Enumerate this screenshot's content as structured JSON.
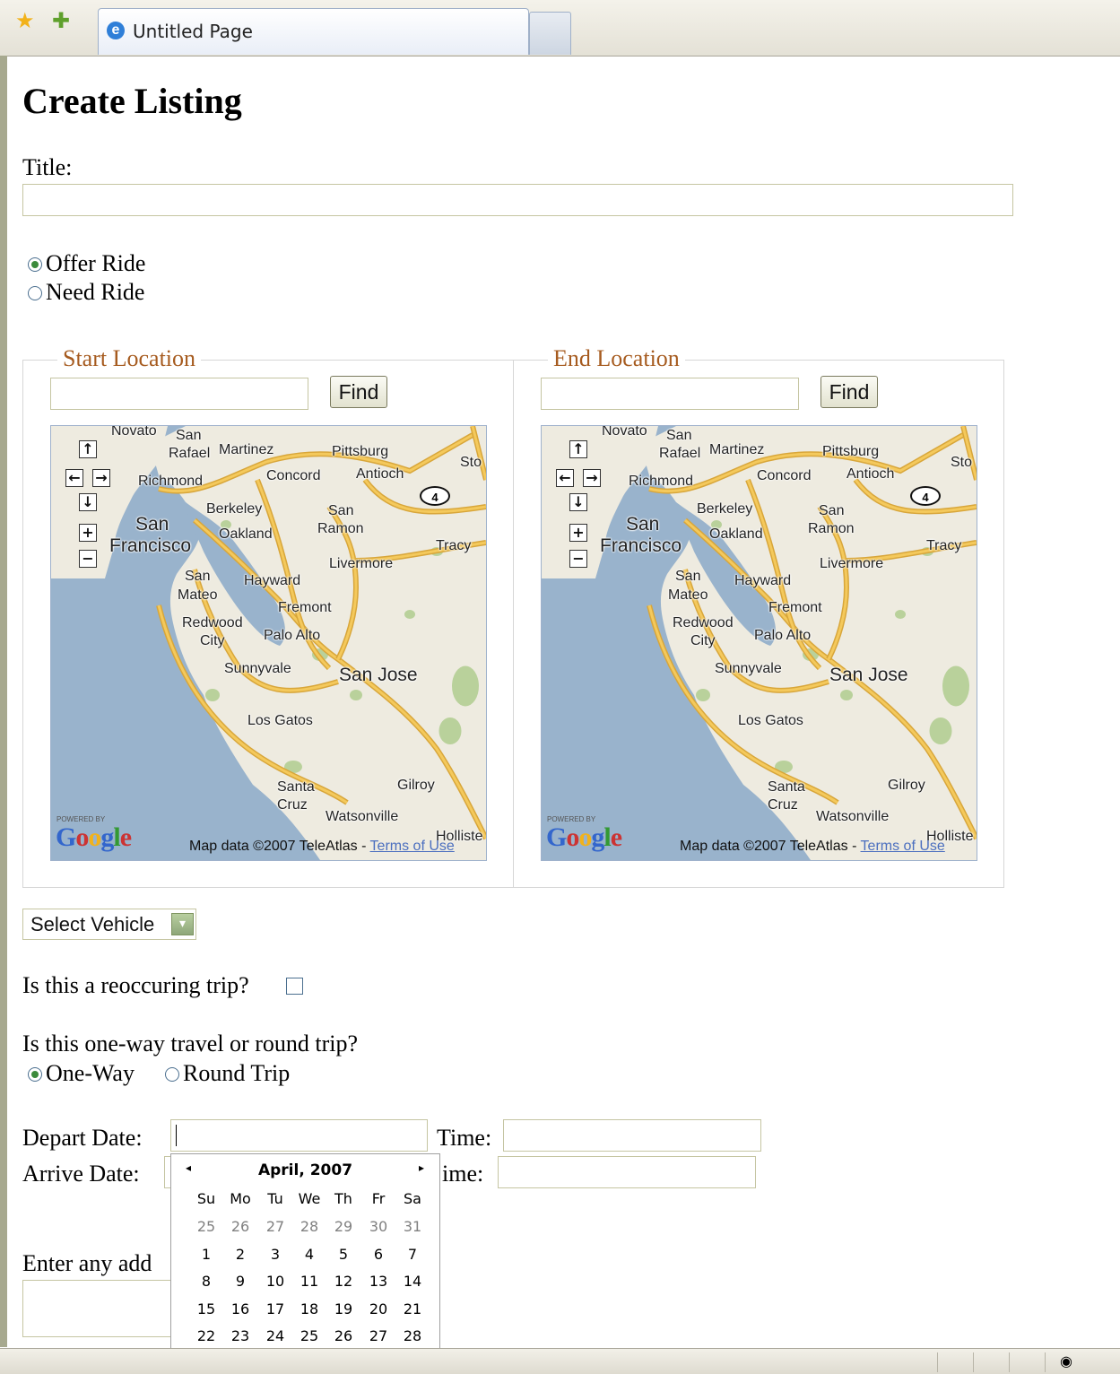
{
  "browser": {
    "tab_title": "Untitled Page",
    "favorites_icon": "star-icon",
    "add_favorites_icon": "add-favorite-icon",
    "page_icon": "ie-icon",
    "privacy_icon": "privacy-eye-icon"
  },
  "page": {
    "heading": "Create Listing",
    "title_label": "Title:",
    "title_value": "",
    "ride_options": [
      {
        "label": "Offer Ride",
        "checked": true
      },
      {
        "label": "Need Ride",
        "checked": false
      }
    ],
    "start_location": {
      "legend": "Start Location",
      "value": "",
      "find_label": "Find"
    },
    "end_location": {
      "legend": "End Location",
      "value": "",
      "find_label": "Find"
    },
    "map": {
      "powered_by": "POWERED BY",
      "logo_text": "Google",
      "attribution": "Map data ©2007 TeleAtlas - ",
      "terms": "Terms of Use",
      "controls": [
        "↑",
        "←",
        "→",
        "↓",
        "+",
        "−"
      ],
      "highway_shield": "4",
      "places": [
        "Novato",
        "San Rafael",
        "Martinez",
        "Pittsburg",
        "Sto",
        "Richmond",
        "Concord",
        "Antioch",
        "Berkeley",
        "San Francisco",
        "Oakland",
        "San Ramon",
        "Tracy",
        "Livermore",
        "San Mateo",
        "Hayward",
        "Fremont",
        "Redwood City",
        "Palo Alto",
        "Sunnyvale",
        "San Jose",
        "Los Gatos",
        "Santa Cruz",
        "Gilroy",
        "Watsonville",
        "Holliste"
      ]
    },
    "vehicle_select": {
      "selected": "Select Vehicle"
    },
    "reoccurring_label": "Is this a reoccuring trip?",
    "reoccurring_checked": false,
    "travel_question": "Is this one-way travel or round trip?",
    "travel_options": [
      {
        "label": "One-Way",
        "checked": true
      },
      {
        "label": "Round Trip",
        "checked": false
      }
    ],
    "depart_label": "Depart Date:",
    "arrive_label": "Arrive Date:",
    "time_label": "Time:",
    "time_label_partial": "ime:",
    "additional_label": "Enter any add"
  },
  "calendar": {
    "month_label": "April, 2007",
    "prev": "◂",
    "next": "▸",
    "weekdays": [
      "Su",
      "Mo",
      "Tu",
      "We",
      "Th",
      "Fr",
      "Sa"
    ],
    "weeks": [
      [
        "25",
        "26",
        "27",
        "28",
        "29",
        "30",
        "31"
      ],
      [
        "1",
        "2",
        "3",
        "4",
        "5",
        "6",
        "7"
      ],
      [
        "8",
        "9",
        "10",
        "11",
        "12",
        "13",
        "14"
      ],
      [
        "15",
        "16",
        "17",
        "18",
        "19",
        "20",
        "21"
      ],
      [
        "22",
        "23",
        "24",
        "25",
        "26",
        "27",
        "28"
      ]
    ],
    "other_month_row": 0
  },
  "colors": {
    "legend": "#a65b1f",
    "input_border": "#c5c5a2",
    "radio_dot": "#3b8a3b"
  }
}
